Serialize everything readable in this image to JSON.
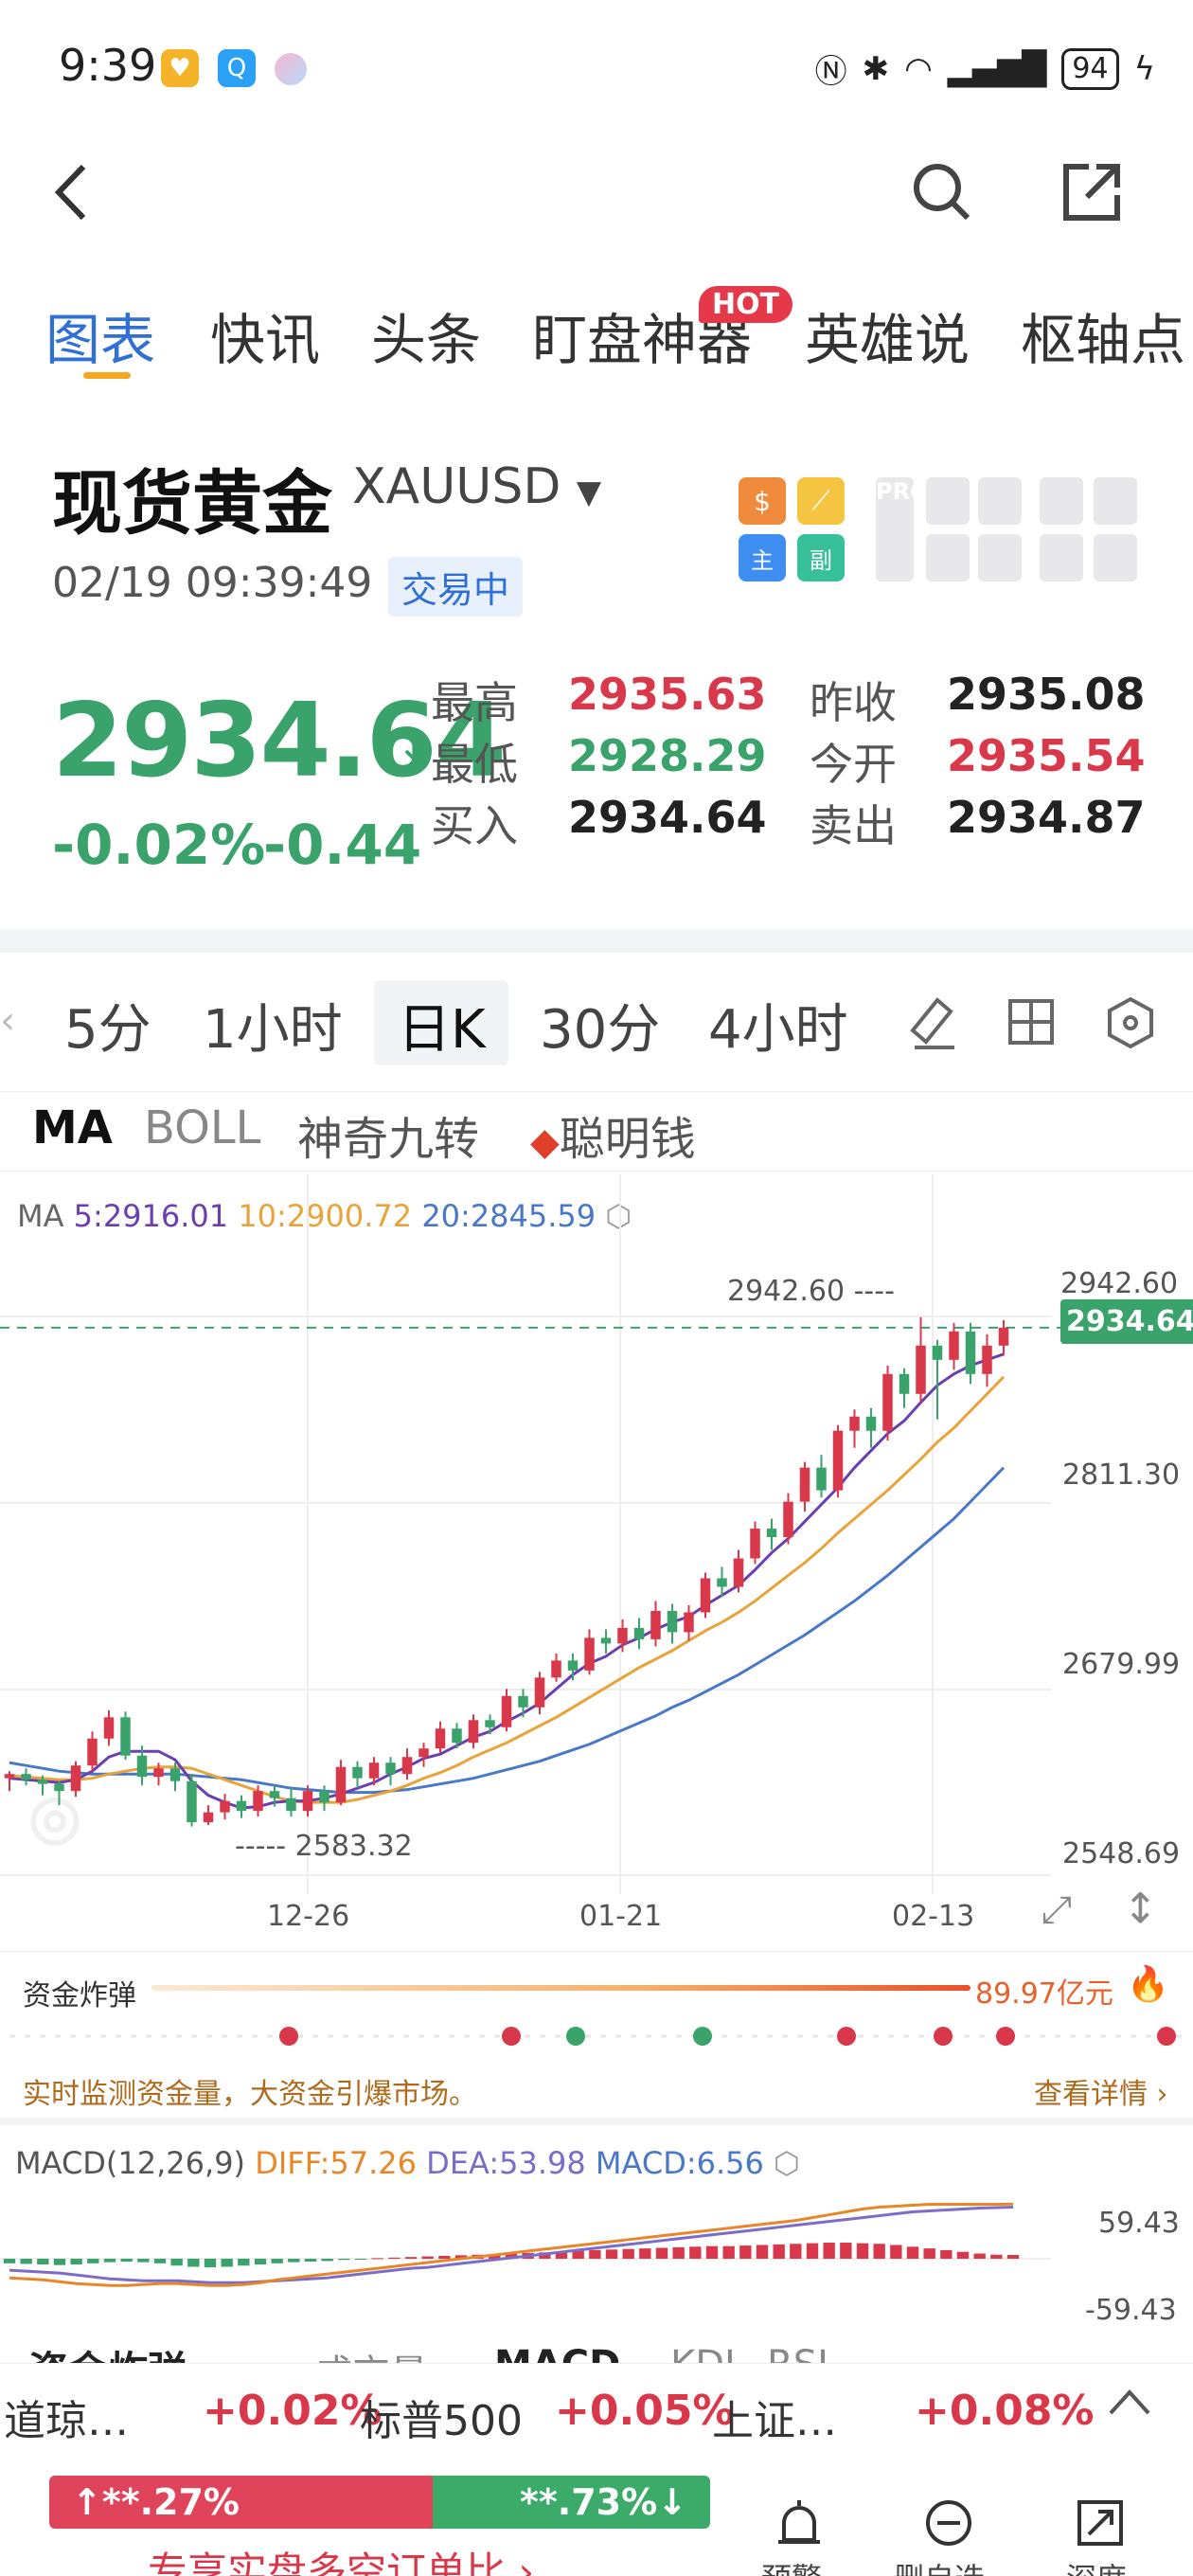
{
  "status_bar": {
    "time": "9:39",
    "battery": "94",
    "signal_icons": [
      "nfc-icon",
      "bluetooth-icon",
      "wifi-icon",
      "signal-icon",
      "battery-icon",
      "charging-icon"
    ]
  },
  "header": {
    "back_icon": "chevron-left-icon",
    "search_icon": "search-icon",
    "share_icon": "share-icon"
  },
  "tabs": [
    {
      "label": "图表",
      "active": true
    },
    {
      "label": "快讯"
    },
    {
      "label": "头条"
    },
    {
      "label": "盯盘神器",
      "badge": "HOT"
    },
    {
      "label": "英雄说"
    },
    {
      "label": "枢轴点"
    }
  ],
  "quote": {
    "name": "现货黄金",
    "symbol": "XAUUSD",
    "timestamp": "02/19 09:39:49",
    "status": "交易中",
    "price": "2934.64",
    "change_pct": "-0.02%",
    "change_abs": "-0.44",
    "stats": [
      {
        "label": "最高",
        "value": "2935.63",
        "color": "red"
      },
      {
        "label": "最低",
        "value": "2928.29",
        "color": "green"
      },
      {
        "label": "买入",
        "value": "2934.64",
        "color": "black"
      },
      {
        "label": "昨收",
        "value": "2935.08",
        "color": "black"
      },
      {
        "label": "今开",
        "value": "2935.54",
        "color": "red"
      },
      {
        "label": "卖出",
        "value": "2934.87",
        "color": "black"
      }
    ],
    "tool_icons": [
      "dollar-icon",
      "line-tool-icon",
      "main-chart-icon",
      "sub-chart-icon"
    ],
    "pro_label": "PRO"
  },
  "periods": [
    "5分",
    "1小时",
    "日K",
    "30分",
    "4小时"
  ],
  "active_period": "日K",
  "indicators": [
    "MA",
    "BOLL",
    "神奇九转",
    "聪明钱"
  ],
  "chart_data": {
    "type": "candlestick",
    "ma_legend": {
      "label": "MA",
      "ma5": "5:2916.01",
      "ma10": "10:2900.72",
      "ma20": "20:2845.59"
    },
    "y_ticks": [
      "2942.60",
      "2811.30",
      "2679.99",
      "2548.69"
    ],
    "x_ticks": [
      "12-26",
      "01-21",
      "02-13"
    ],
    "current_price_tag": "2934.64",
    "high_marker": "2942.60",
    "low_marker": "2583.32",
    "ylim": [
      2548.69,
      2942.6
    ],
    "candles": [
      [
        2617,
        2620,
        2608,
        2622
      ],
      [
        2620,
        2616,
        2612,
        2624
      ],
      [
        2616,
        2613,
        2605,
        2619
      ],
      [
        2613,
        2608,
        2598,
        2615
      ],
      [
        2608,
        2626,
        2604,
        2629
      ],
      [
        2626,
        2645,
        2622,
        2650
      ],
      [
        2645,
        2660,
        2640,
        2665
      ],
      [
        2660,
        2633,
        2630,
        2664
      ],
      [
        2633,
        2618,
        2612,
        2640
      ],
      [
        2618,
        2624,
        2612,
        2628
      ],
      [
        2624,
        2615,
        2608,
        2628
      ],
      [
        2615,
        2586,
        2583,
        2620
      ],
      [
        2586,
        2593,
        2584,
        2598
      ],
      [
        2593,
        2601,
        2588,
        2606
      ],
      [
        2601,
        2594,
        2589,
        2605
      ],
      [
        2594,
        2608,
        2590,
        2612
      ],
      [
        2608,
        2603,
        2597,
        2612
      ],
      [
        2603,
        2594,
        2590,
        2610
      ],
      [
        2594,
        2608,
        2590,
        2612
      ],
      [
        2608,
        2600,
        2594,
        2612
      ],
      [
        2600,
        2625,
        2598,
        2630
      ],
      [
        2625,
        2617,
        2610,
        2629
      ],
      [
        2617,
        2628,
        2612,
        2632
      ],
      [
        2628,
        2620,
        2612,
        2632
      ],
      [
        2620,
        2632,
        2616,
        2638
      ],
      [
        2632,
        2638,
        2625,
        2642
      ],
      [
        2638,
        2652,
        2635,
        2657
      ],
      [
        2652,
        2642,
        2638,
        2656
      ],
      [
        2642,
        2658,
        2638,
        2662
      ],
      [
        2658,
        2653,
        2648,
        2662
      ],
      [
        2653,
        2675,
        2650,
        2680
      ],
      [
        2675,
        2667,
        2660,
        2680
      ],
      [
        2667,
        2688,
        2662,
        2692
      ],
      [
        2688,
        2700,
        2685,
        2705
      ],
      [
        2700,
        2693,
        2686,
        2705
      ],
      [
        2693,
        2716,
        2690,
        2722
      ],
      [
        2716,
        2712,
        2705,
        2722
      ],
      [
        2712,
        2723,
        2706,
        2729
      ],
      [
        2723,
        2715,
        2708,
        2730
      ],
      [
        2715,
        2735,
        2710,
        2742
      ],
      [
        2735,
        2720,
        2712,
        2740
      ],
      [
        2720,
        2734,
        2714,
        2739
      ],
      [
        2734,
        2758,
        2730,
        2762
      ],
      [
        2758,
        2752,
        2745,
        2766
      ],
      [
        2752,
        2772,
        2748,
        2778
      ],
      [
        2772,
        2793,
        2768,
        2798
      ],
      [
        2793,
        2787,
        2778,
        2800
      ],
      [
        2787,
        2812,
        2782,
        2818
      ],
      [
        2812,
        2836,
        2805,
        2840
      ],
      [
        2836,
        2820,
        2815,
        2845
      ],
      [
        2820,
        2862,
        2815,
        2866
      ],
      [
        2862,
        2872,
        2850,
        2877
      ],
      [
        2872,
        2862,
        2850,
        2878
      ],
      [
        2862,
        2902,
        2855,
        2908
      ],
      [
        2902,
        2888,
        2878,
        2906
      ],
      [
        2888,
        2922,
        2882,
        2942
      ],
      [
        2922,
        2912,
        2870,
        2926
      ],
      [
        2912,
        2932,
        2905,
        2938
      ],
      [
        2932,
        2902,
        2895,
        2938
      ],
      [
        2902,
        2922,
        2893,
        2930
      ],
      [
        2922,
        2934.64,
        2915,
        2940
      ]
    ],
    "ma5": [
      2617,
      2616,
      2615,
      2614,
      2616,
      2622,
      2632,
      2636,
      2636,
      2636,
      2630,
      2615,
      2605,
      2600,
      2596,
      2597,
      2600,
      2601,
      2601,
      2603,
      2606,
      2610,
      2614,
      2620,
      2625,
      2631,
      2634,
      2640,
      2646,
      2650,
      2657,
      2663,
      2670,
      2680,
      2690,
      2698,
      2703,
      2711,
      2716,
      2722,
      2727,
      2731,
      2739,
      2746,
      2753,
      2764,
      2776,
      2786,
      2798,
      2810,
      2822,
      2836,
      2848,
      2860,
      2869,
      2882,
      2894,
      2902,
      2908,
      2912,
      2916
    ],
    "ma10": [
      2619,
      2618,
      2617,
      2616,
      2616,
      2617,
      2620,
      2622,
      2624,
      2625,
      2625,
      2624,
      2620,
      2616,
      2612,
      2608,
      2604,
      2601,
      2600,
      2600,
      2600,
      2602,
      2605,
      2608,
      2612,
      2617,
      2621,
      2626,
      2632,
      2637,
      2642,
      2648,
      2654,
      2660,
      2667,
      2674,
      2681,
      2688,
      2695,
      2701,
      2707,
      2714,
      2721,
      2727,
      2734,
      2742,
      2751,
      2760,
      2769,
      2779,
      2790,
      2800,
      2810,
      2820,
      2831,
      2842,
      2854,
      2864,
      2876,
      2888,
      2900
    ],
    "ma20": [
      2628,
      2626,
      2624,
      2622,
      2621,
      2620,
      2620,
      2620,
      2620,
      2620,
      2620,
      2619,
      2618,
      2617,
      2616,
      2614,
      2612,
      2610,
      2609,
      2608,
      2607,
      2607,
      2607,
      2608,
      2609,
      2611,
      2613,
      2615,
      2617,
      2620,
      2623,
      2626,
      2629,
      2633,
      2637,
      2641,
      2646,
      2651,
      2656,
      2661,
      2667,
      2672,
      2678,
      2684,
      2690,
      2697,
      2704,
      2711,
      2718,
      2726,
      2734,
      2742,
      2751,
      2760,
      2770,
      2780,
      2790,
      2800,
      2812,
      2824,
      2836
    ]
  },
  "fund_bomb": {
    "label": "资金炸弹",
    "value": "89.97亿元",
    "note": "实时监测资金量，大资金引爆市场。",
    "detail_link": "查看详情"
  },
  "macd": {
    "label": "MACD(12,26,9)",
    "diff": "DIFF:57.26",
    "dea": "DEA:53.98",
    "macd": "MACD:6.56",
    "y_top": "59.43",
    "y_bottom": "-59.43",
    "bars": [
      -8,
      -9,
      -10,
      -11,
      -10,
      -8,
      -6,
      -5,
      -6,
      -8,
      -12,
      -14,
      -15,
      -14,
      -12,
      -10,
      -8,
      -6,
      -5,
      -4,
      -2,
      -1,
      1,
      2,
      3,
      4,
      5,
      6,
      7,
      8,
      9,
      10,
      11,
      12,
      14,
      15,
      16,
      17,
      18,
      19,
      20,
      21,
      22,
      22,
      23,
      24,
      25,
      26,
      27,
      28,
      28,
      27,
      26,
      24,
      21,
      18,
      15,
      12,
      9,
      7,
      6.56
    ],
    "diff_series": [
      -20,
      -21,
      -22,
      -24,
      -26,
      -27,
      -28,
      -28,
      -27,
      -26,
      -26,
      -27,
      -28,
      -28,
      -27,
      -25,
      -22,
      -20,
      -18,
      -16,
      -14,
      -12,
      -10,
      -8,
      -6,
      -4,
      -2,
      0,
      2,
      4,
      6,
      8,
      10,
      12,
      14,
      16,
      18,
      20,
      22,
      24,
      26,
      28,
      30,
      32,
      34,
      36,
      38,
      40,
      43,
      46,
      49,
      52,
      54,
      55,
      56,
      57,
      57,
      57,
      57,
      57,
      57.26
    ],
    "dea_series": [
      -12,
      -13,
      -14,
      -15,
      -17,
      -19,
      -21,
      -22,
      -23,
      -23,
      -23,
      -24,
      -25,
      -25,
      -25,
      -24,
      -23,
      -22,
      -21,
      -20,
      -18,
      -16,
      -14,
      -12,
      -10,
      -9,
      -7,
      -5,
      -3,
      -1,
      1,
      3,
      5,
      7,
      9,
      11,
      13,
      15,
      17,
      19,
      21,
      23,
      25,
      27,
      29,
      31,
      33,
      35,
      37,
      39,
      41,
      43,
      45,
      47,
      49,
      50,
      51,
      52,
      53,
      53.5,
      53.98
    ]
  },
  "bottom_tabs": [
    "资金炸弹",
    "成交量",
    "MACD",
    "KDJ",
    "RSI"
  ],
  "ticker": [
    {
      "name": "道琼…",
      "value": "+0.02%"
    },
    {
      "name": "标普500",
      "value": "+0.05%"
    },
    {
      "name": "上证…",
      "value": "+0.08%"
    }
  ],
  "sentiment": {
    "up": "**.27%",
    "down": "**.73%"
  },
  "promo": "专享实盘多空订单比",
  "bottom_actions": [
    {
      "icon": "alarm-icon",
      "label": "预警"
    },
    {
      "icon": "remove-icon",
      "label": "删自选"
    },
    {
      "icon": "landscape-icon",
      "label": "深度"
    }
  ]
}
